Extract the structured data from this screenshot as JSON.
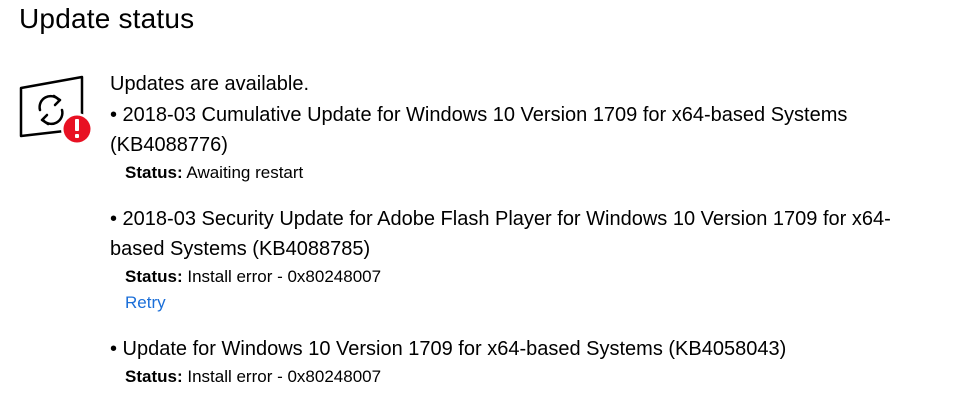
{
  "page": {
    "title": "Update status"
  },
  "status_icon": {
    "name": "update-error-icon",
    "badge_color": "#e81123",
    "badge_glyph": "!"
  },
  "summary": "Updates are available.",
  "updates": [
    {
      "title": "• 2018-03 Cumulative Update for Windows 10 Version 1709 for x64-based Systems (KB4088776)",
      "status_label": "Status:",
      "status_value": " Awaiting restart",
      "action": null
    },
    {
      "title": "• 2018-03 Security Update for Adobe Flash Player for Windows 10 Version 1709 for x64-based Systems (KB4088785)",
      "status_label": "Status:",
      "status_value": " Install error - 0x80248007",
      "action": "Retry"
    },
    {
      "title": "• Update for Windows 10 Version 1709 for x64-based Systems (KB4058043)",
      "status_label": "Status:",
      "status_value": " Install error - 0x80248007",
      "action": null
    }
  ],
  "colors": {
    "link": "#1a6ed8",
    "text": "#000000",
    "error_badge": "#e81123"
  }
}
